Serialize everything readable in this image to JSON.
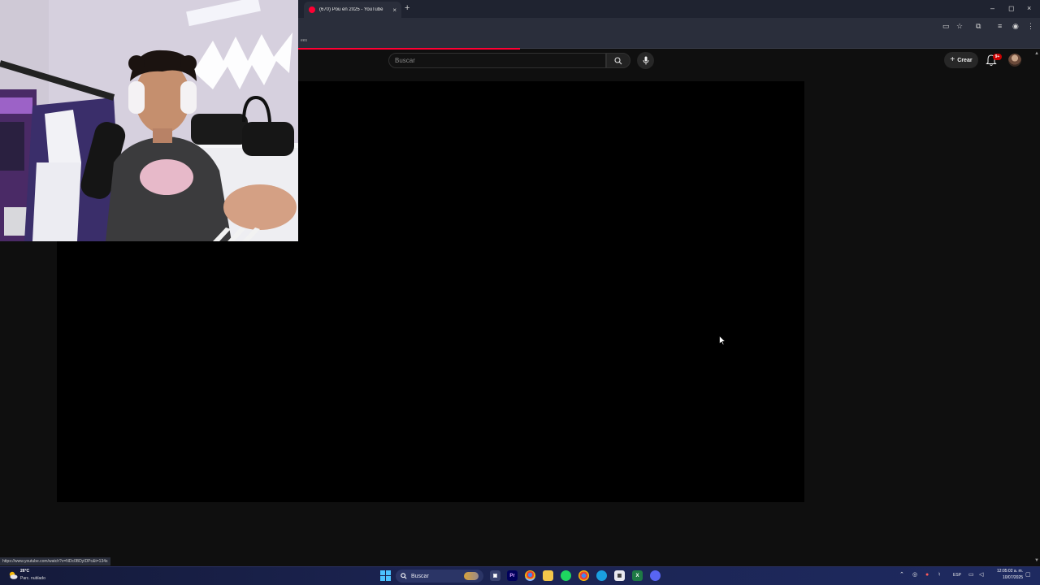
{
  "browser": {
    "tab_title": "(670) Pou en 2025 - YouTube",
    "tab_close": "×",
    "new_tab": "+",
    "window_controls": {
      "minimize": "–",
      "maximize": "◻",
      "close": "×"
    },
    "bookmarks_fragment": "ees",
    "load_progress": 0.5,
    "status_url": "https://www.youtube.com/watch?v=NDc0BDyIDPc&t=134s"
  },
  "youtube": {
    "search_placeholder": "Buscar",
    "create_label": "Crear",
    "notification_badge": "9+",
    "accent_color": "#ff0033"
  },
  "taskbar": {
    "weather": {
      "temp": "26°C",
      "desc": "Parc. nublado"
    },
    "search_label": "Buscar",
    "language": "ESP",
    "time": "12:05:02 a. m.",
    "date": "10/07/2025"
  }
}
